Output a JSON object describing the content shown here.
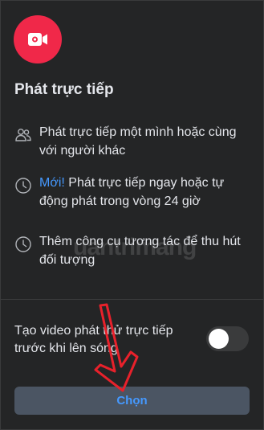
{
  "icons": {
    "header": "live-video-camera-icon",
    "feature1": "people-icon",
    "feature2": "clock-icon",
    "feature3": "clock-icon"
  },
  "colors": {
    "background": "#242526",
    "accent": "#f02849",
    "link": "#4599ff",
    "button_bg": "#4b5563",
    "annotation_arrow": "#e8212b"
  },
  "title": "Phát trực tiếp",
  "features": [
    {
      "text": "Phát trực tiếp một mình hoặc cùng với người khác"
    },
    {
      "tag": "Mới!",
      "text": " Phát trực tiếp ngay hoặc tự động phát trong vòng 24 giờ"
    },
    {
      "text": "Thêm công cụ tương tác để thu hút đối tượng"
    }
  ],
  "test_toggle": {
    "label": "Tạo video phát thử trực tiếp trước khi lên sóng",
    "state": "off"
  },
  "choose_button": "Chọn",
  "watermark": "uantrimang"
}
